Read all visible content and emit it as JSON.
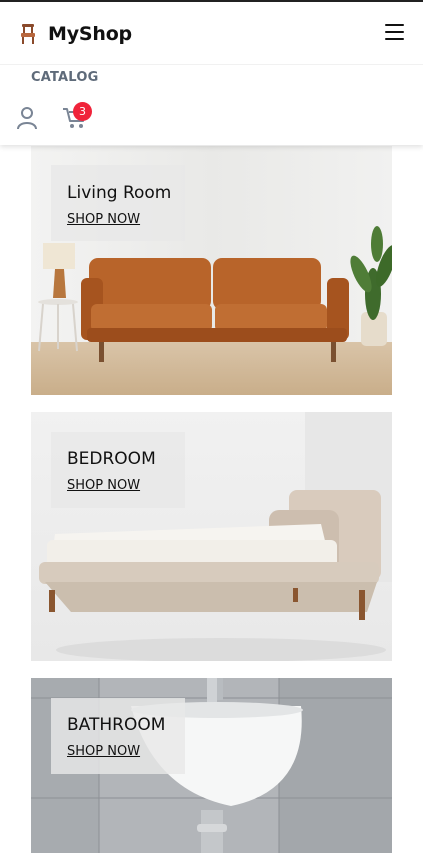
{
  "header": {
    "logo_text": "MyShop",
    "logo_icon": "chair-icon",
    "menu_icon": "hamburger-menu-icon",
    "nav_catalog": "CATALOG",
    "account_icon": "user-icon",
    "cart_icon": "cart-icon",
    "cart_count": "3",
    "badge_color": "#f0233a"
  },
  "categories": [
    {
      "title": "Living Room",
      "cta": "SHOP NOW"
    },
    {
      "title": "BEDROOM",
      "cta": "SHOP NOW"
    },
    {
      "title": "BATHROOM",
      "cta": "SHOP NOW"
    }
  ]
}
